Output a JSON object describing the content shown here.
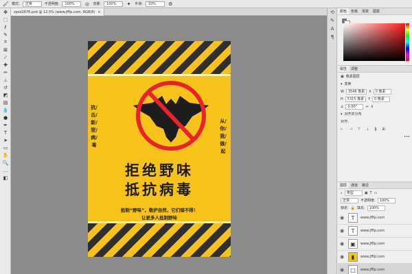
{
  "options_bar": {
    "mode_label": "模式:",
    "mode_value": "正常",
    "opacity_label": "不透明度:",
    "opacity_value": "100%",
    "flow_label": "流量:",
    "flow_value": "100%",
    "smooth_label": "平滑:",
    "smooth_value": "10%"
  },
  "document_tab": {
    "title": "zpsd2676.psd @ 12.5% (www.jfflp.com, RGB/8)",
    "close": "×"
  },
  "poster": {
    "headline_1": "拒绝野味",
    "headline_2": "抵抗病毒",
    "left_vertical": "抗/击/新/型/病/毒",
    "right_vertical": "从/你/我/做/起",
    "slogan_1": "抵制“野味”，敬护自然，它们错不得！",
    "slogan_2": "让更多人抵制野味",
    "colors": {
      "yellow": "#f7c21a",
      "dark": "#2f2f2f",
      "red": "#e8232b"
    }
  },
  "right_panel": {
    "color_tabs": [
      "颜色",
      "色板",
      "渐变",
      "图案"
    ],
    "props_tabs": [
      "属性",
      "调整"
    ],
    "pixel_layer_label": "像素图层",
    "transform_label": "变换",
    "w_label": "W",
    "w_value": "3546 像素",
    "x_label": "X",
    "x_value": "0 像素",
    "h_label": "H",
    "h_value": "5315 像素",
    "y_label": "Y",
    "y_value": "0 像素",
    "angle_value": "0.00°",
    "align_label": "对齐并分布",
    "align_sub": "对齐:",
    "layers_tabs": [
      "图层",
      "通道",
      "路径"
    ],
    "kind_label": "类型",
    "blend_value": "正常",
    "opacity_label": "不透明度:",
    "opacity_value": "100%",
    "lock_label": "锁定:",
    "fill_label": "填充:",
    "fill_value": "100%",
    "layers": [
      {
        "name": "www.jfflp.com",
        "thumb": "T"
      },
      {
        "name": "www.jfflp.com",
        "thumb": "T"
      },
      {
        "name": "www.jfflp.com",
        "thumb": "▣"
      },
      {
        "name": "www.jfflp.com",
        "thumb": "▮"
      },
      {
        "name": "www.jfflp.com",
        "thumb": "□"
      }
    ]
  },
  "icons": [
    "move-icon",
    "marquee-icon",
    "lasso-icon",
    "crop-icon",
    "eyedropper-icon",
    "brush-icon",
    "stamp-icon",
    "eraser-icon",
    "gradient-icon",
    "pen-icon",
    "type-icon",
    "hand-icon",
    "zoom-icon",
    "eye-icon"
  ]
}
